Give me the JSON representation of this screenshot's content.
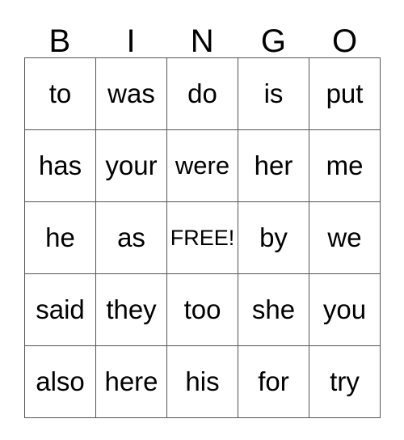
{
  "card": {
    "title": "BINGO",
    "headers": [
      "B",
      "I",
      "N",
      "G",
      "O"
    ],
    "free_space_label": "FREE!",
    "free_space_position": {
      "row": 2,
      "col": 2
    },
    "colors": {
      "background": "#ffffff",
      "text": "#000000",
      "grid_line": "#555555"
    },
    "rows": [
      {
        "cells": [
          {
            "text": "to"
          },
          {
            "text": "was"
          },
          {
            "text": "do"
          },
          {
            "text": "is"
          },
          {
            "text": "put"
          }
        ]
      },
      {
        "cells": [
          {
            "text": "has"
          },
          {
            "text": "your"
          },
          {
            "text": "were"
          },
          {
            "text": "her"
          },
          {
            "text": "me"
          }
        ]
      },
      {
        "cells": [
          {
            "text": "he"
          },
          {
            "text": "as"
          },
          {
            "text": "FREE!"
          },
          {
            "text": "by"
          },
          {
            "text": "we"
          }
        ]
      },
      {
        "cells": [
          {
            "text": "said"
          },
          {
            "text": "they"
          },
          {
            "text": "too"
          },
          {
            "text": "she"
          },
          {
            "text": "you"
          }
        ]
      },
      {
        "cells": [
          {
            "text": "also"
          },
          {
            "text": "here"
          },
          {
            "text": "his"
          },
          {
            "text": "for"
          },
          {
            "text": "try"
          }
        ]
      }
    ]
  }
}
